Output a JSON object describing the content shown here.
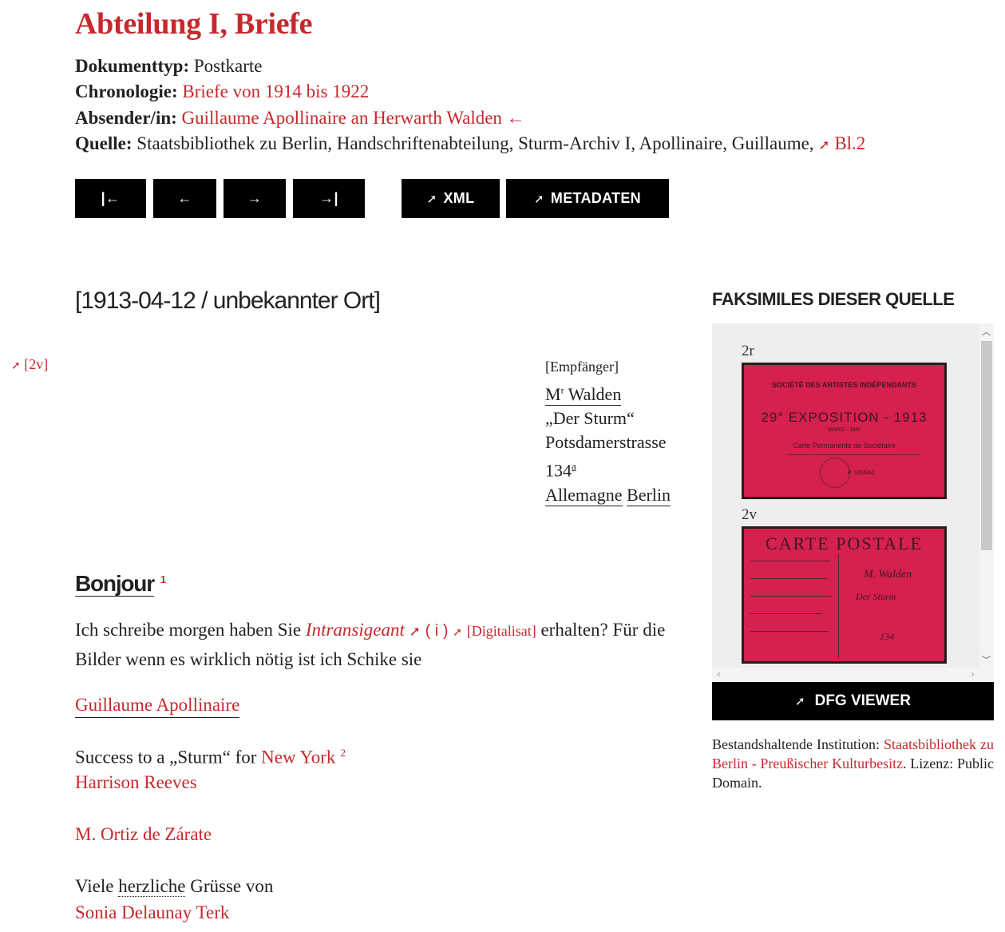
{
  "title": "Abteilung I, Briefe",
  "meta": {
    "doctype_label": "Dokumenttyp:",
    "doctype_value": "Postkarte",
    "chronology_label": "Chronologie:",
    "chronology_value": "Briefe von 1914 bis 1922",
    "sender_label": "Absender/in:",
    "sender_value": "Guillaume Apollinaire an Herwarth Walden ←",
    "source_label": "Quelle:",
    "source_value": "Staatsbibliothek zu Berlin, Handschriftenabteilung, Sturm-Archiv I, Apollinaire, Guillaume,",
    "source_link": "Bl.2"
  },
  "nav": {
    "first": "|←",
    "prev": "←",
    "next": "→",
    "last": "→|",
    "xml": "XML",
    "metadata": "METADATEN"
  },
  "letter": {
    "date": "[1913-04-12 / unbekannter Ort]",
    "page_ref": "[2v]",
    "address": {
      "recipient_label": "[Empfänger]",
      "name_prefix": "M",
      "name_sup": "r",
      "name": "Walden",
      "line2": "„Der Sturm“",
      "line3": "Potsdamerstrasse",
      "line4_number": "134",
      "line4_sup": "a",
      "line5_country": "Allemagne",
      "line5_city": "Berlin"
    },
    "greeting": "Bonjour",
    "greeting_note": "1",
    "para1_before": "Ich schreibe morgen haben Sie",
    "para1_link": "Intransigeant",
    "para1_info": "( i )",
    "para1_digital": "[Digitalisat]",
    "para1_after": "erhalten? Für die Bilder wenn es wirklich nötig ist ich Schike sie",
    "signature1": "Guillaume Apollinaire",
    "success_before": "Success to a „Sturm“ for",
    "success_link": "New York",
    "success_note": "2",
    "signature2": "Harrison Reeves",
    "signature3": "M. Ortiz de Zárate",
    "closing_before": "Viele",
    "closing_word": "herzliche",
    "closing_after": "Grüsse von",
    "signature4": "Sonia Delaunay Terk"
  },
  "facsimiles": {
    "heading": "FAKSIMILES DIESER QUELLE",
    "items": [
      {
        "label": "2r",
        "lines": [
          "SOCIÉTÉ DES ARTISTES INDÉPENDANTS",
          "29° EXPOSITION - 1913",
          "MARS – MAI",
          "Carte Permanente de Sociétaire",
          "P. SIGNAC"
        ]
      },
      {
        "label": "2v",
        "lines": [
          "CARTE POSTALE",
          "M. Walden",
          "Der Sturm",
          "134"
        ]
      }
    ],
    "viewer_button": "DFG VIEWER",
    "institution_label": "Bestandshaltende Institution:",
    "institution_link": "Staatsbibliothek zu Berlin - Preußischer Kulturbesitz",
    "license": ". Lizenz: Public Domain."
  },
  "colors": {
    "accent": "#c8282d",
    "button_bg": "#000000",
    "card_red": "#d6204d"
  }
}
